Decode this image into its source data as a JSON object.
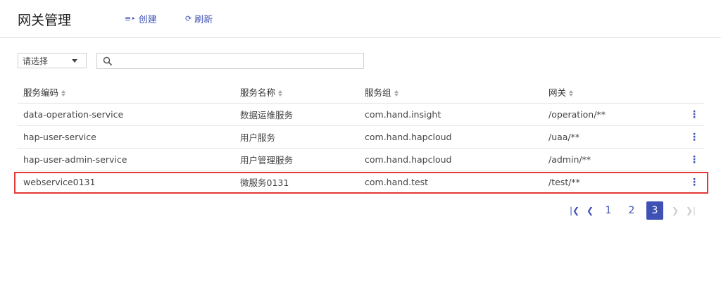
{
  "header": {
    "title": "网关管理",
    "create_label": "创建",
    "refresh_label": "刷新"
  },
  "filter": {
    "select_value": "请选择",
    "search_placeholder": ""
  },
  "table": {
    "columns": [
      "服务编码",
      "服务名称",
      "服务组",
      "网关"
    ],
    "rows": [
      [
        "data-operation-service",
        "数据运维服务",
        "com.hand.insight",
        "/operation/**"
      ],
      [
        "hap-user-service",
        "用户服务",
        "com.hand.hapcloud",
        "/uaa/**"
      ],
      [
        "hap-user-admin-service",
        "用户管理服务",
        "com.hand.hapcloud",
        "/admin/**"
      ],
      [
        "webservice0131",
        "微服务0131",
        "com.hand.test",
        "/test/**"
      ]
    ],
    "row_menu_icon": "more-vertical-icon"
  },
  "pagination": {
    "pages": [
      "1",
      "2",
      "3"
    ],
    "current": "3"
  },
  "colors": {
    "accent": "#3f51b5",
    "highlight": "#e53935"
  }
}
